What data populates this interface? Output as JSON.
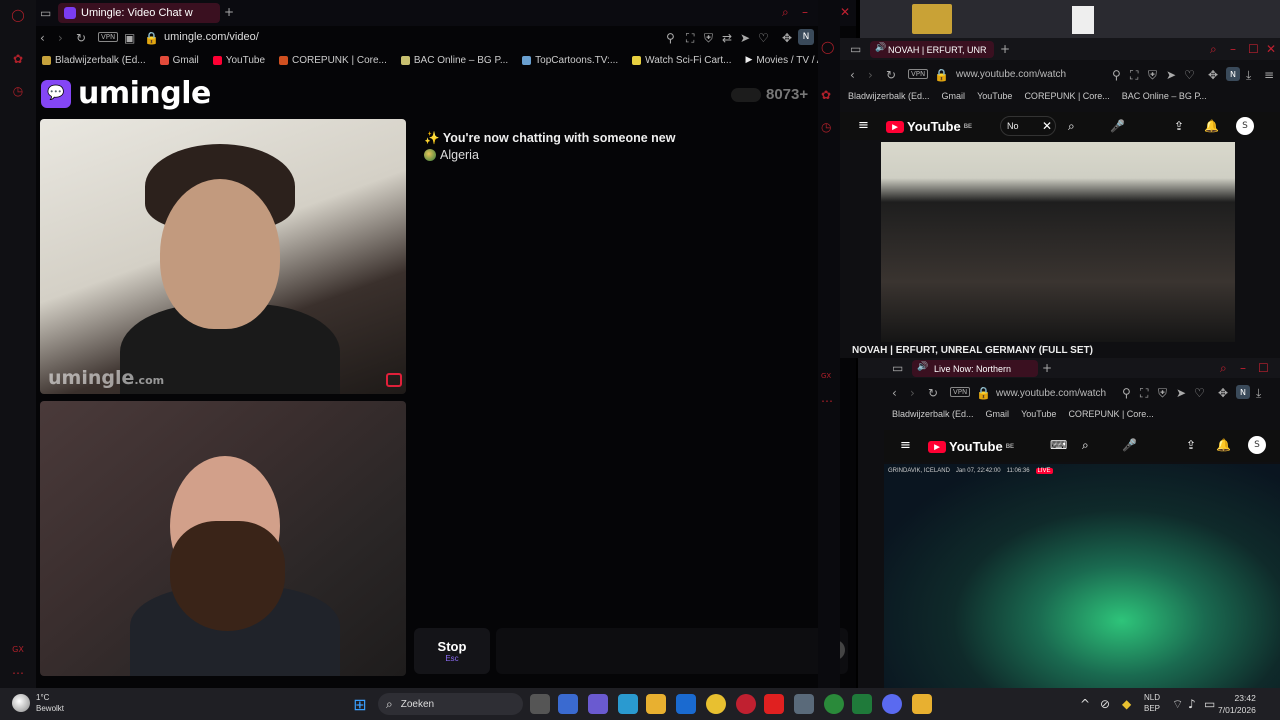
{
  "main_window": {
    "tab_title": "Umingle: Video Chat w",
    "url": "umingle.com/video/",
    "vpn_label": "VPN",
    "profile_initial": "N",
    "bookmarks": [
      "Bladwijzerbalk (Ed...",
      "Gmail",
      "YouTube",
      "COREPUNK | Core...",
      "BAC Online – BG P...",
      "TopCartoons.TV:...",
      "Watch Sci-Fi Cart...",
      "Movies / TV / Ani..."
    ]
  },
  "umingle": {
    "logo_text": "umingle",
    "online_count": "8073+",
    "watermark_main": "umingle",
    "watermark_suffix": ".com",
    "chat_message": "You're now chatting with someone new",
    "chat_emoji": "✨",
    "chat_country": "Algeria",
    "stop_label": "Stop",
    "stop_shortcut": "Esc"
  },
  "window_top_right": {
    "tab_title": "NOVAH | ERFURT, UNR",
    "url": "www.youtube.com/watch",
    "vpn_label": "VPN",
    "profile_initial": "N",
    "bookmarks": [
      "Bladwijzerbalk (Ed...",
      "Gmail",
      "YouTube",
      "COREPUNK | Core...",
      "BAC Online – BG P..."
    ],
    "yt_logo": "YouTube",
    "yt_region": "BE",
    "search_value": "No",
    "avatar_initial": "S",
    "video_title": "NOVAH | ERFURT, UNREAL GERMANY (FULL SET)"
  },
  "window_bottom_right": {
    "tab_title": "Live Now: Northern",
    "url": "www.youtube.com/watch",
    "vpn_label": "VPN",
    "profile_initial": "N",
    "bookmarks": [
      "Bladwijzerbalk (Ed...",
      "Gmail",
      "YouTube",
      "COREPUNK | Core..."
    ],
    "yt_logo": "YouTube",
    "yt_region": "BE",
    "avatar_initial": "S",
    "live_location": "GRINDAVIK, ICELAND",
    "live_date": "Jan 07, 22:42:00",
    "live_time": "11:06:36",
    "live_badge": "LIVE"
  },
  "taskbar": {
    "weather_temp": "1°C",
    "weather_desc": "Bewolkt",
    "search_placeholder": "Zoeken",
    "lang_top": "NLD",
    "lang_bottom": "BEP",
    "time": "23:42",
    "date": "7/01/2026"
  },
  "colors": {
    "accent": "#8446f5",
    "opera_red": "#b0202a",
    "youtube_red": "#ff0033"
  }
}
